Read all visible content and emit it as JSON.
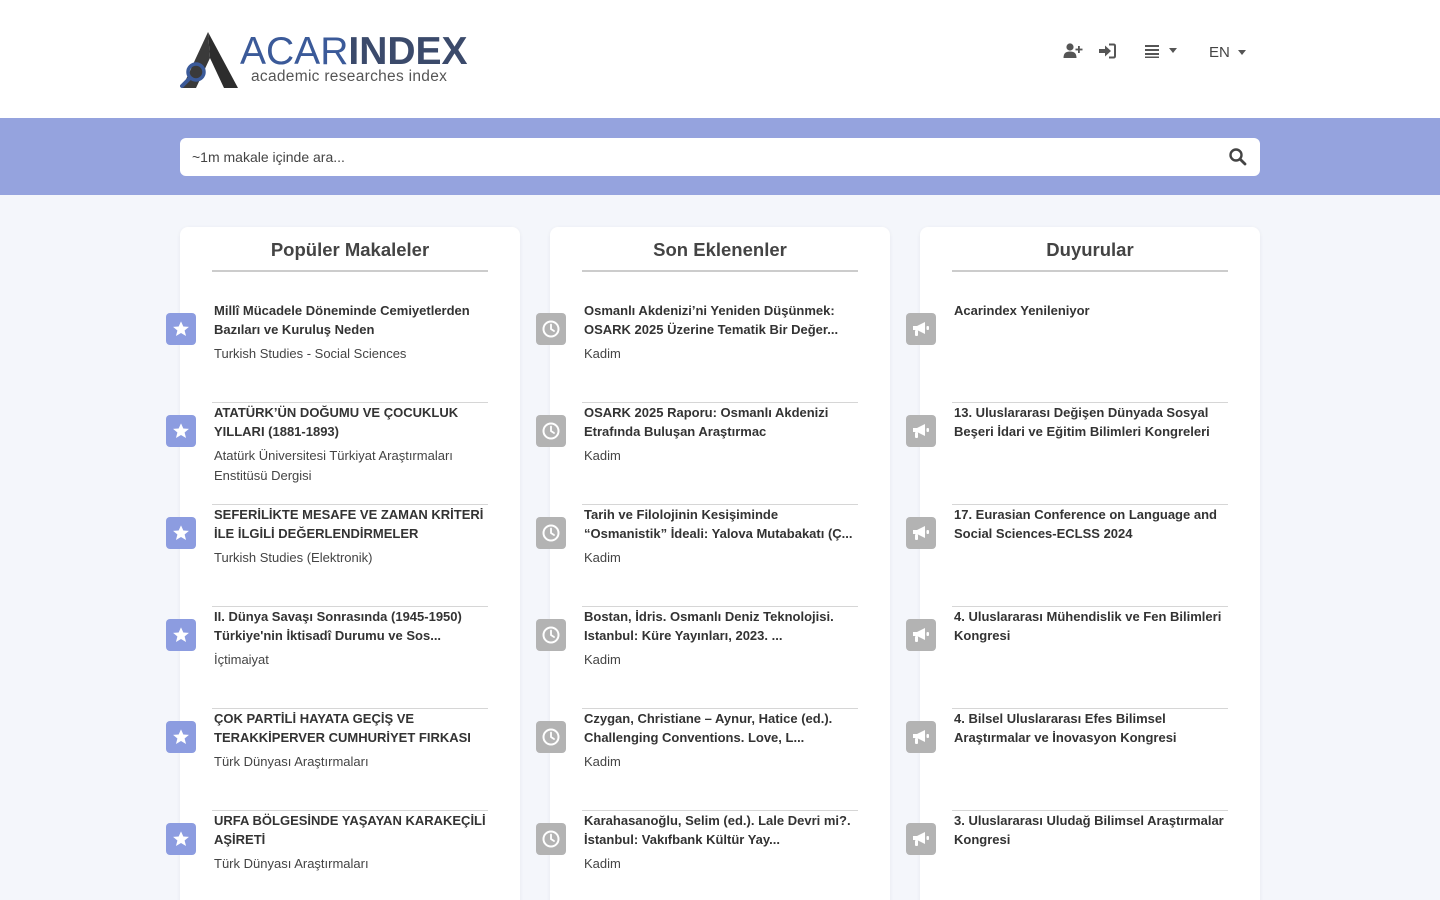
{
  "brand": {
    "name_part1": "ACAR",
    "name_part2": "INDEX",
    "tagline": "academic researches index"
  },
  "nav": {
    "language": "EN",
    "icons": [
      "add-user-icon",
      "sign-in-icon",
      "list-icon"
    ]
  },
  "search": {
    "placeholder": "~1m makale içinde ara...",
    "value": ""
  },
  "colors": {
    "band": "#95a3de",
    "star_badge": "#8c9ce0",
    "gray_badge": "#b3b3b3",
    "logo_blue": "#3b5a99"
  },
  "columns": [
    {
      "title": "Popüler Makaleler",
      "icon": "star-icon",
      "items": [
        {
          "title": "Millî Mücadele Döneminde Cemiyetlerden Bazıları ve Kuruluş Neden",
          "source": "Turkish Studies - Social Sciences"
        },
        {
          "title": "ATATÜRK’ÜN DOĞUMU VE ÇOCUKLUK YILLARI (1881-1893)",
          "source": "Atatürk Üniversitesi Türkiyat Araştırmaları Enstitüsü Dergisi"
        },
        {
          "title": "SEFERİLİKTE MESAFE VE ZAMAN KRİTERİ İLE İLGİLİ DEĞERLENDİRMELER",
          "source": "Turkish Studies (Elektronik)"
        },
        {
          "title": "II. Dünya Savaşı Sonrasında (1945-1950) Türkiye'nin İktisadî Durumu ve Sos...",
          "source": "İçtimaiyat"
        },
        {
          "title": "ÇOK PARTİLİ HAYATA GEÇİŞ VE TERAKKİPERVER CUMHURİYET FIRKASI",
          "source": "Türk Dünyası Araştırmaları"
        },
        {
          "title": "URFA BÖLGESİNDE YAŞAYAN KARAKEÇİLİ AŞİRETİ",
          "source": "Türk Dünyası Araştırmaları"
        }
      ]
    },
    {
      "title": "Son Eklenenler",
      "icon": "clock-icon",
      "items": [
        {
          "title": "Osmanlı Akdenizi’ni Yeniden Düşünmek: OSARK 2025 Üzerine Tematik Bir Değer...",
          "source": "Kadim"
        },
        {
          "title": "OSARK 2025 Raporu: Osmanlı Akdenizi Etrafında Buluşan Araştırmac",
          "source": "Kadim"
        },
        {
          "title": "Tarih ve Filolojinin Kesişiminde “Osmanistik” İdeali: Yalova Mutabakatı (Ç...",
          "source": "Kadim"
        },
        {
          "title": "Bostan, İdris. Osmanlı Deniz Teknolojisi. Istanbul: Küre Yayınları, 2023. ...",
          "source": "Kadim"
        },
        {
          "title": "Czygan, Christiane – Aynur, Hatice (ed.). Challenging Conventions. Love, L...",
          "source": "Kadim"
        },
        {
          "title": "Karahasanoğlu, Selim (ed.). Lale Devri mi?. İstanbul: Vakıfbank Kültür Yay...",
          "source": "Kadim"
        }
      ]
    },
    {
      "title": "Duyurular",
      "icon": "megaphone-icon",
      "items": [
        {
          "title": "Acarindex Yenileniyor",
          "source": ""
        },
        {
          "title": "13. Uluslararası Değişen Dünyada Sosyal Beşeri İdari ve Eğitim Bilimleri Kongreleri",
          "source": ""
        },
        {
          "title": "17. Eurasian Conference on Language and Social Sciences-ECLSS 2024",
          "source": ""
        },
        {
          "title": "4. Uluslararası Mühendislik ve Fen Bilimleri Kongresi",
          "source": ""
        },
        {
          "title": "4. Bilsel Uluslararası Efes Bilimsel Araştırmalar ve İnovasyon Kongresi",
          "source": ""
        },
        {
          "title": "3. Uluslararası Uludağ Bilimsel Araştırmalar Kongresi",
          "source": ""
        }
      ]
    }
  ]
}
